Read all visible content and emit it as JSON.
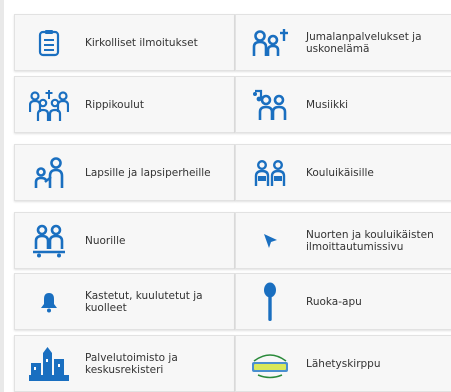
{
  "colors": {
    "accent": "#1a6fc0",
    "text": "#333333",
    "tile_bg": "#f7f7f7"
  },
  "tiles": [
    {
      "label": "Kirkolliset ilmoitukset",
      "icon": "bulletin-list-icon"
    },
    {
      "label": "Jumalanpalvelukset ja uskonelämä",
      "icon": "worship-people-cross-icon"
    },
    {
      "label": "Rippikoulut",
      "icon": "confirmation-group-icon"
    },
    {
      "label": "Musiikki",
      "icon": "music-people-icon"
    },
    {
      "label": "Lapsille ja lapsiperheille",
      "icon": "parent-child-icon"
    },
    {
      "label": "Kouluikäisille",
      "icon": "schoolchildren-icon"
    },
    {
      "label": "Nuorille",
      "icon": "youth-skateboard-icon"
    },
    {
      "label": "Nuorten ja kouluikäisten ilmoittautumissivu",
      "icon": "cursor-arrow-icon"
    },
    {
      "label": "Kastetut, kuulutetut ja kuolleet",
      "icon": "bell-icon"
    },
    {
      "label": "Ruoka-apu",
      "icon": "spoon-icon"
    },
    {
      "label": "Palvelutoimisto ja keskusrekisteri",
      "icon": "church-office-icon"
    },
    {
      "label": "Lähetyskirppu",
      "icon": "mission-fleamarket-logo",
      "logo_text": "Lähetys KIRPPU"
    }
  ]
}
